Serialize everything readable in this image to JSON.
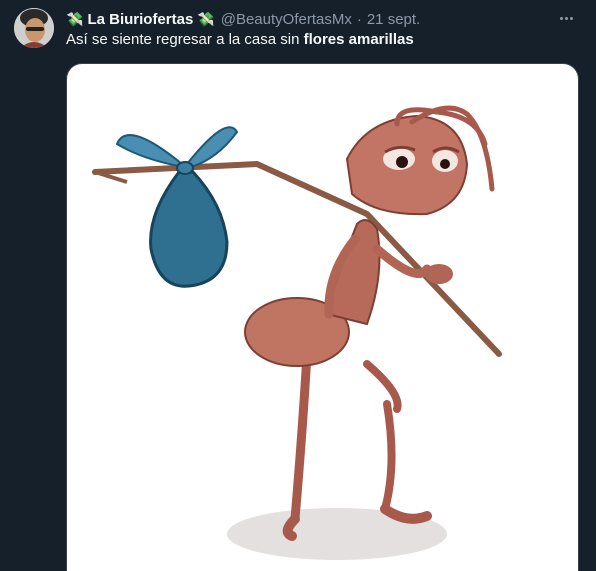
{
  "tweet": {
    "display_name": "La Biuriofertas",
    "name_emoji_left": "💸",
    "name_emoji_right": "💸",
    "handle": "@BeautyOfertasMx",
    "separator": "·",
    "date": "21 sept.",
    "text_plain": "Así se siente regresar a la casa sin ",
    "text_bold": "flores amarillas",
    "more_icon": "more-horizontal-icon",
    "colors": {
      "background": "#15202b",
      "text": "#f7f9f9",
      "muted": "#8b98a5",
      "media_bg": "#ffffff",
      "bag": "#2f6f8f",
      "ant": "#b86a5a"
    }
  }
}
